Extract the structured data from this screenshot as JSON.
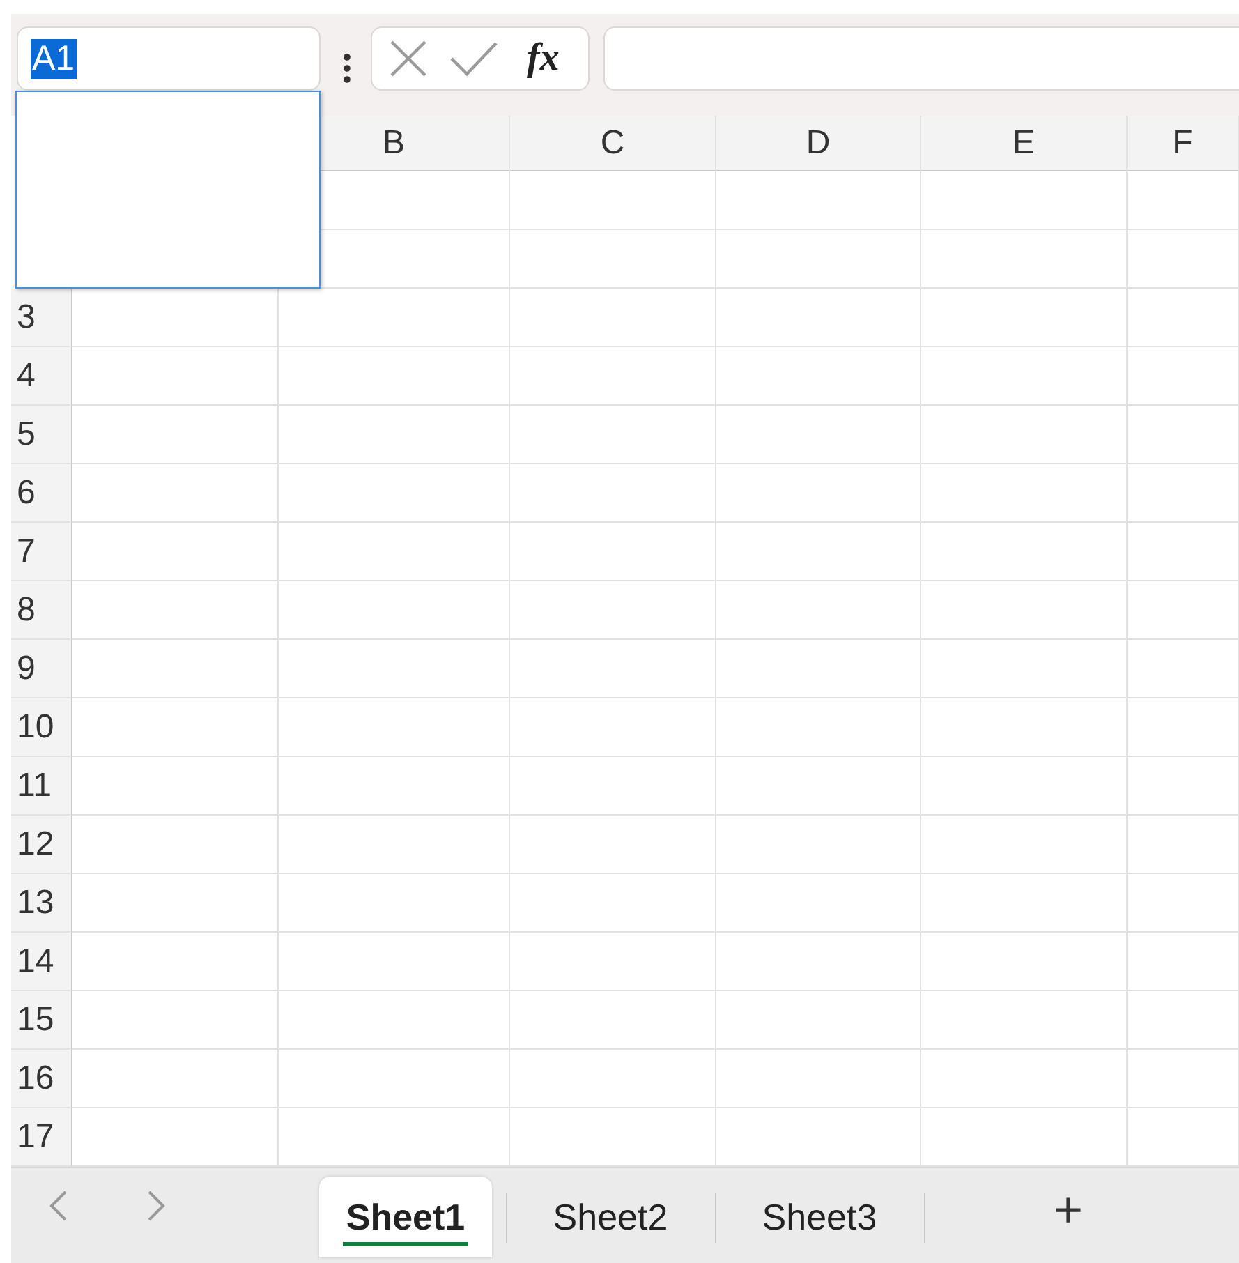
{
  "name_box": {
    "value": "A1",
    "text_selected": true,
    "dropdown_open": true
  },
  "formula_bar": {
    "function_label": "fx"
  },
  "columns": [
    "B",
    "C",
    "D",
    "E",
    "F"
  ],
  "rows": [
    "3",
    "4",
    "5",
    "6",
    "7",
    "8",
    "9",
    "10",
    "11",
    "12",
    "13",
    "14",
    "15",
    "16",
    "17"
  ],
  "sheets": [
    {
      "label": "Sheet1",
      "selected": true
    },
    {
      "label": "Sheet2",
      "selected": false
    },
    {
      "label": "Sheet3",
      "selected": false
    }
  ],
  "add_sheet": "+"
}
